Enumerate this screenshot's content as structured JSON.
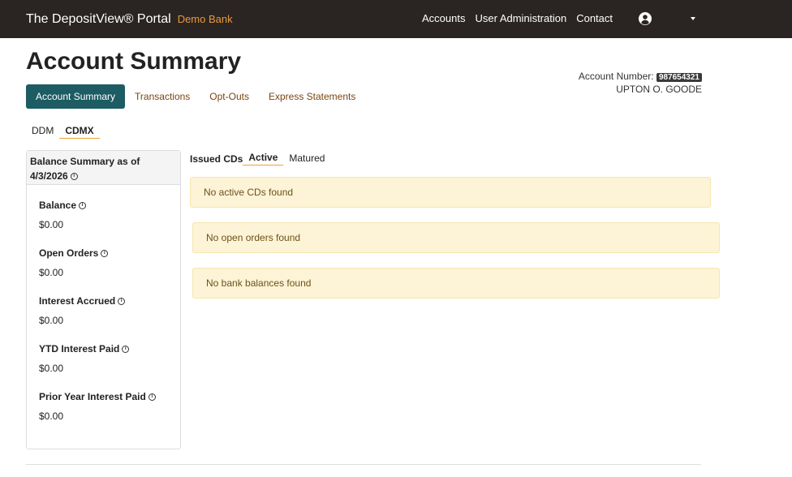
{
  "navbar": {
    "brand": "The DepositView® Portal",
    "brand_sub": "Demo Bank",
    "links": [
      "Accounts",
      "User Administration",
      "Contact"
    ],
    "user_icon": "user-circle-icon",
    "caret_icon": "caret-down-icon"
  },
  "page": {
    "title": "Account Summary"
  },
  "account": {
    "number_label": "Account Number:",
    "number": "987654321",
    "holder": "UPTON O. GOODE"
  },
  "tabs": [
    "Account Summary",
    "Transactions",
    "Opt-Outs",
    "Express Statements"
  ],
  "subtabs": [
    "DDM",
    "CDMX"
  ],
  "balance": {
    "header": "Balance Summary as of 4/3/2026",
    "info_glyph": "i",
    "items": [
      {
        "label": "Balance",
        "value": "$0.00"
      },
      {
        "label": "Open Orders",
        "value": "$0.00"
      },
      {
        "label": "Interest Accrued",
        "value": "$0.00"
      },
      {
        "label": "YTD Interest Paid",
        "value": "$0.00"
      },
      {
        "label": "Prior Year Interest Paid",
        "value": "$0.00"
      }
    ]
  },
  "cds": {
    "label": "Issued CDs",
    "tabs": [
      "Active",
      "Matured"
    ]
  },
  "alerts": [
    "No active CDs found",
    "No open orders found",
    "No bank balances found"
  ],
  "colors": {
    "navbar": "#2a2522",
    "accent": "#1d5c63",
    "brand_sub": "#e8973f",
    "alert_bg": "#fdf3d6",
    "link": "#7a4510"
  }
}
